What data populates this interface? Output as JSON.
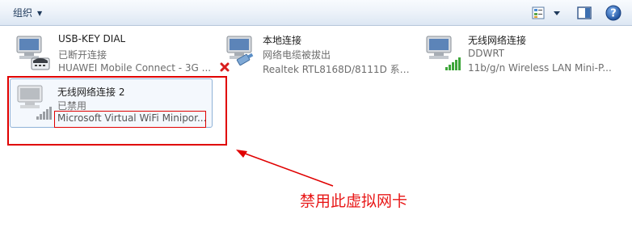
{
  "toolbar": {
    "organize_label": "组织",
    "views_icon": "change-view-icon",
    "preview_icon": "preview-pane-icon",
    "help_icon": "help-icon"
  },
  "connections": [
    {
      "name": "USB-KEY DIAL",
      "status": "已断开连接",
      "device": "HUAWEI Mobile Connect - 3G ...",
      "icon": "dialup-modem-icon"
    },
    {
      "name": "本地连接",
      "status": "网络电缆被拔出",
      "device": "Realtek RTL8168D/8111D 系列...",
      "icon": "ethernet-unplugged-icon"
    },
    {
      "name": "无线网络连接",
      "status": "DDWRT",
      "device": "11b/g/n  Wireless LAN Mini-P...",
      "icon": "wireless-signal-icon"
    },
    {
      "name": "无线网络连接 2",
      "status": "已禁用",
      "device": "Microsoft Virtual WiFi Minipor...",
      "icon": "wireless-disabled-icon"
    }
  ],
  "annotation": {
    "text": "禁用此虚拟网卡",
    "color": "#e81818"
  }
}
